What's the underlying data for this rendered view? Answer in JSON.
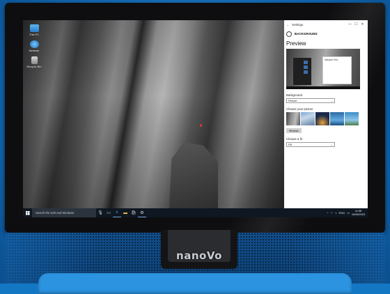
{
  "brand": "nanoVo",
  "desktop": {
    "icons": [
      {
        "label": "This PC",
        "icon": "computer-icon"
      },
      {
        "label": "Network",
        "icon": "network-icon"
      },
      {
        "label": "Recycle Bin",
        "icon": "recycle-bin-icon"
      }
    ]
  },
  "settings": {
    "window_title": "Settings",
    "breadcrumb": "BACKGROUND",
    "preview_heading": "Preview",
    "preview_window_text": "Sample Text",
    "background_label": "Background",
    "background_value": "Picture",
    "choose_picture_label": "Choose your picture",
    "browse_label": "Browse",
    "fit_label": "Choose a fit",
    "fit_value": "Fill",
    "window_controls": {
      "minimize": "—",
      "maximize": "☐",
      "close": "✕"
    }
  },
  "taskbar": {
    "search_placeholder": "Search the web and Windows",
    "tray_text": "ENG",
    "time": "11:58",
    "date": "16/08/2015"
  },
  "colors": {
    "body_blue": "#1477c4",
    "taskbar": "#0f1722",
    "accent": "#6fa8dc"
  }
}
